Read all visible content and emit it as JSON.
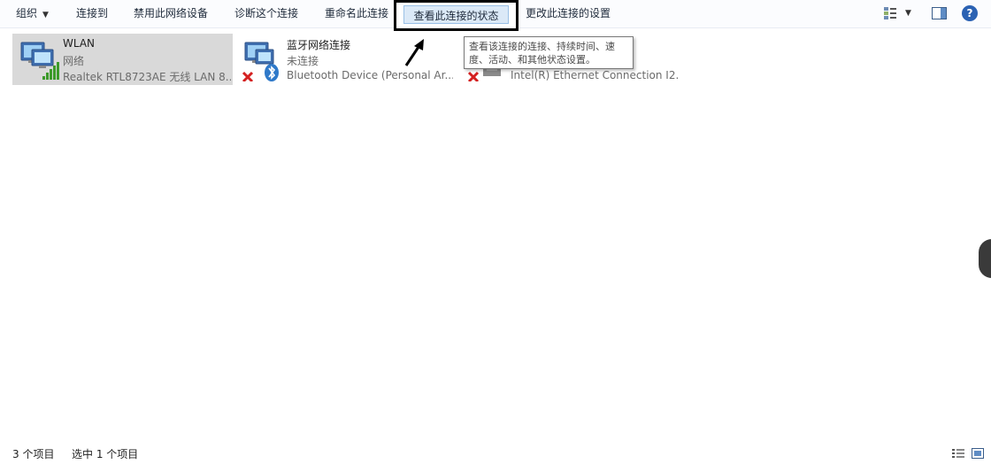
{
  "toolbar": {
    "organize": "组织",
    "connect_to": "连接到",
    "disable_device": "禁用此网络设备",
    "diagnose": "诊断这个连接",
    "rename": "重命名此连接",
    "view_status": "查看此连接的状态",
    "change_settings": "更改此连接的设置",
    "icons": [
      "change-view-icon",
      "preview-pane-icon",
      "help-icon"
    ],
    "help_glyph": "?"
  },
  "tooltip": {
    "line1": "查看该连接的连接、持续时间、速",
    "line2": "度、活动、和其他状态设置。"
  },
  "connections": [
    {
      "name": "WLAN",
      "status": "网络",
      "device": "Realtek RTL8723AE 无线 LAN 8...",
      "selected": true,
      "icon": "wifi-network-icon"
    },
    {
      "name": "蓝牙网络连接",
      "status": "未连接",
      "device": "Bluetooth Device (Personal Ar...",
      "selected": false,
      "icon": "bluetooth-network-icon"
    },
    {
      "name": "",
      "status": "",
      "device": "Intel(R) Ethernet Connection I2...",
      "selected": false,
      "icon": "ethernet-network-icon"
    }
  ],
  "statusbar": {
    "item_count": "3 个项目",
    "selected_count": "选中 1 个项目"
  },
  "colors": {
    "accent": "#2b62b3",
    "selected_bg": "#d9d9d9",
    "highlight_bg": "#dbe9f7",
    "error_red": "#d42020"
  }
}
